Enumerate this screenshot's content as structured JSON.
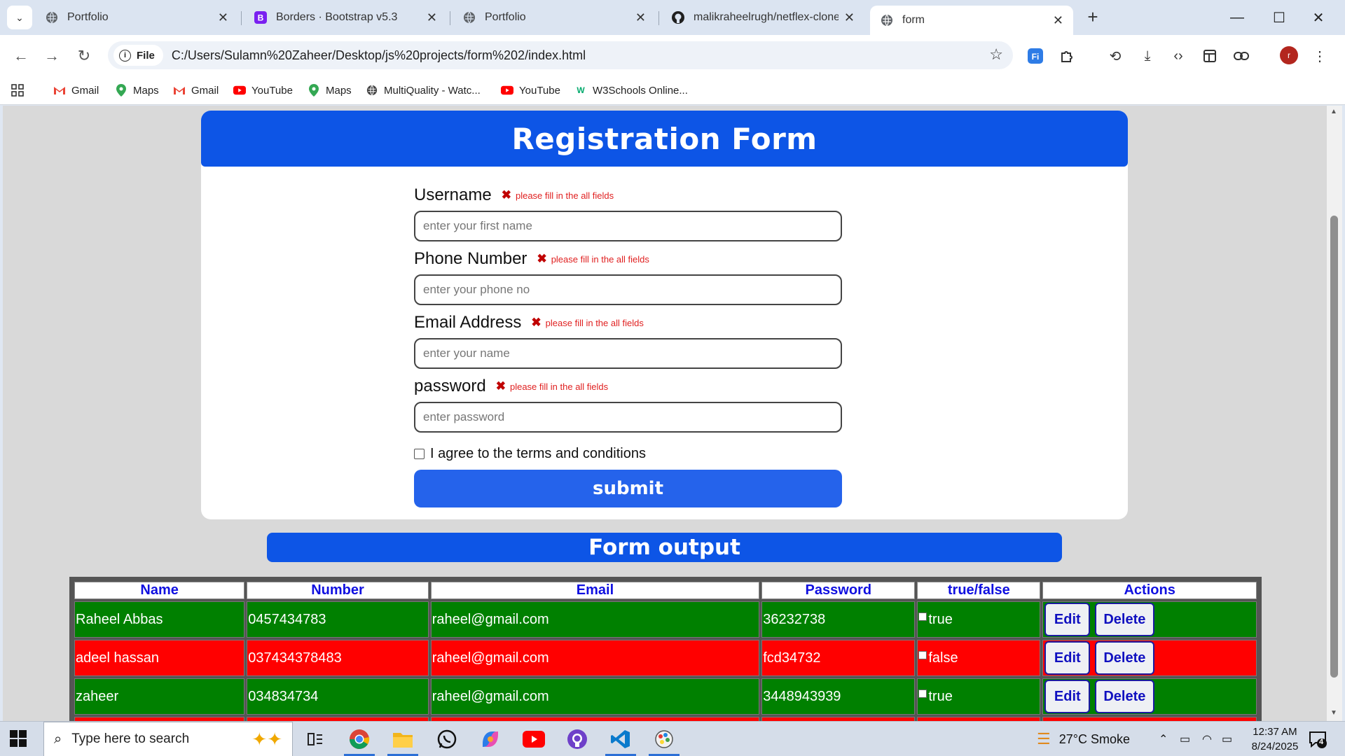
{
  "browser": {
    "tabs": [
      {
        "title": "Portfolio",
        "icon": "globe-icon",
        "active": false
      },
      {
        "title": "Borders · Bootstrap v5.3",
        "icon": "bootstrap-icon",
        "active": false
      },
      {
        "title": "Portfolio",
        "icon": "globe-icon",
        "active": false
      },
      {
        "title": "malikraheelrugh/netflex-clone:",
        "icon": "github-icon",
        "active": false
      },
      {
        "title": "form",
        "icon": "globe-icon",
        "active": true
      }
    ],
    "chip_label": "File",
    "url": "C:/Users/Sulamn%20Zaheer/Desktop/js%20projects/form%202/index.html",
    "profile_initial": "r",
    "bookmarks": [
      "Gmail",
      "Maps",
      "Gmail",
      "YouTube",
      "Maps",
      "MultiQuality - Watc...",
      "YouTube",
      "W3Schools Online..."
    ]
  },
  "form": {
    "title": "Registration Form",
    "error_text": "please fill in the all fields",
    "fields": [
      {
        "label": "Username",
        "placeholder": "enter your first name"
      },
      {
        "label": "Phone Number",
        "placeholder": "enter your phone no"
      },
      {
        "label": "Email Address",
        "placeholder": "enter your name"
      },
      {
        "label": "password",
        "placeholder": "enter password"
      }
    ],
    "agree_label": "I agree to the terms and conditions",
    "submit_label": "submit"
  },
  "output": {
    "title": "Form output",
    "columns": [
      "Name",
      "Number",
      "Email",
      "Password",
      "true/false",
      "Actions"
    ],
    "edit_label": "Edit",
    "delete_label": "Delete",
    "rows": [
      {
        "name": "Raheel Abbas",
        "number": "0457434783",
        "email": "raheel@gmail.com",
        "password": "36232738",
        "flag": "true",
        "row_color": "green"
      },
      {
        "name": "adeel hassan",
        "number": "037434378483",
        "email": "raheel@gmail.com",
        "password": "fcd34732",
        "flag": "false",
        "row_color": "red"
      },
      {
        "name": "zaheer",
        "number": "034834734",
        "email": "raheel@gmail.com",
        "password": "3448943939",
        "flag": "true",
        "row_color": "green"
      }
    ]
  },
  "taskbar": {
    "search_placeholder": "Type here to search",
    "weather": "27°C  Smoke",
    "time": "12:37 AM",
    "date": "8/24/2025",
    "notification_count": "4"
  },
  "colors": {
    "header_blue": "#0d55e6",
    "submit_blue": "#2563eb",
    "row_green": "#008000",
    "row_red": "#ff0000",
    "error_red": "#e02020"
  }
}
